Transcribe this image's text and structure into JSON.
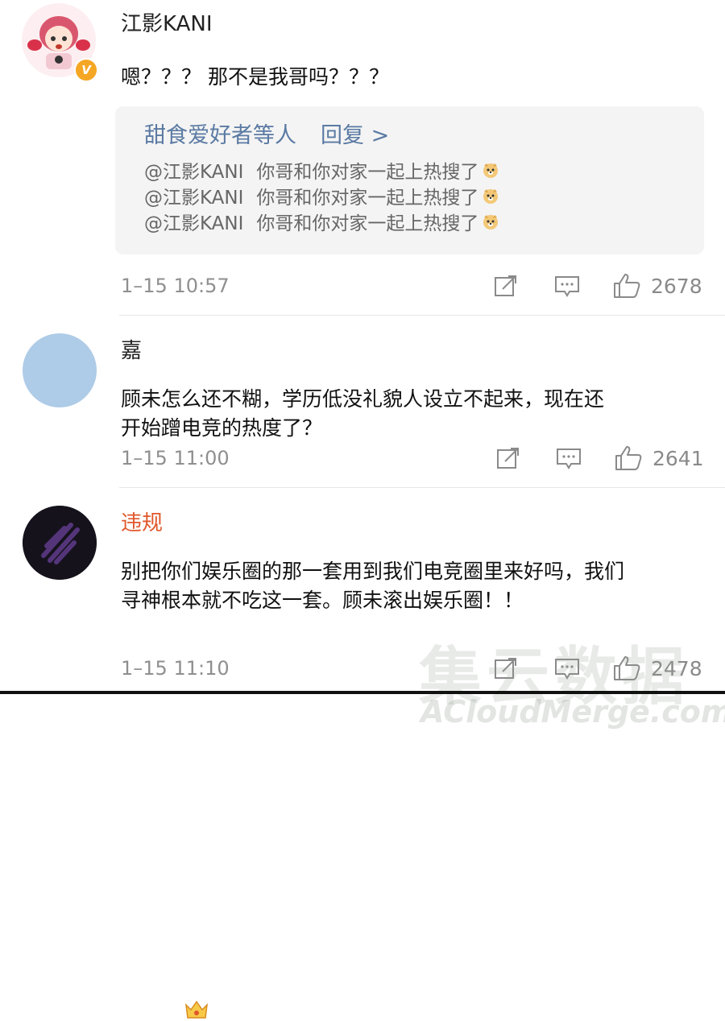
{
  "colors": {
    "accent_link": "#5a7aa3",
    "muted": "#8f8f8f",
    "violation_name": "#e0572a",
    "reply_bg": "#f4f4f4"
  },
  "comments": [
    {
      "username": "江影KANI",
      "text": "嗯？？？ 那不是我哥吗？？？",
      "time": "1–15 10:57",
      "likes": "2678",
      "avatar_icon": "anime-avatar-icon",
      "badge": "V",
      "replies": {
        "header": "甜食爱好者等人",
        "link": "回复 >",
        "lines": [
          {
            "mention": "@江影KANI",
            "text": "你哥和你对家一起上热搜了"
          },
          {
            "mention": "@江影KANI",
            "text": "你哥和你对家一起上热搜了"
          },
          {
            "mention": "@江影KANI",
            "text": "你哥和你对家一起上热搜了"
          }
        ]
      }
    },
    {
      "username": "嘉",
      "text_lines": [
        "顾未怎么还不糊，学历低没礼貌人设立不起来，现在还",
        "开始蹭电竞的热度了？"
      ],
      "time": "1–15 11:00",
      "likes": "2641",
      "avatar_icon": "plain-blue-avatar"
    },
    {
      "username": "违规",
      "text_lines": [
        "别把你们娱乐圈的那一套用到我们电竞圈里来好吗，我们",
        "寻神根本就不吃这一套。顾未滚出娱乐圈！！"
      ],
      "time": "1–15 11:10",
      "likes": "2478",
      "avatar_icon": "dark-brush-avatar",
      "badge_icon": "crown-icon"
    }
  ],
  "watermark": {
    "cn": "集云数据",
    "en": "ACloudMerge.com"
  }
}
